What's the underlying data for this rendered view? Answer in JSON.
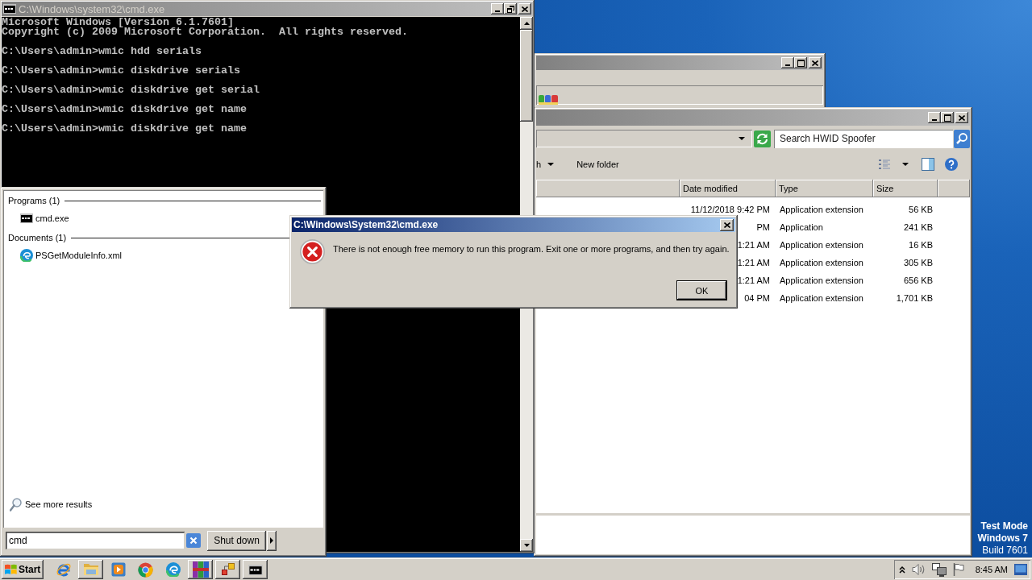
{
  "cmd_window": {
    "title": "C:\\Windows\\system32\\cmd.exe",
    "banner_lines": [
      "Microsoft Windows [Version 6.1.7601]",
      "Copyright (c) 2009 Microsoft Corporation.  All rights reserved."
    ],
    "command_lines": [
      "C:\\Users\\admin>wmic hdd serials",
      "C:\\Users\\admin>wmic diskdrive serials",
      "C:\\Users\\admin>wmic diskdrive get serial",
      "C:\\Users\\admin>wmic diskdrive get name",
      "C:\\Users\\admin>wmic diskdrive get name"
    ]
  },
  "explorer_window": {
    "search": {
      "placeholder": "Search HWID Spoofer"
    },
    "toolbar": [
      {
        "label": "h",
        "kind": "menu"
      },
      {
        "label": "New folder",
        "kind": "button"
      }
    ],
    "columns": [
      "Date modified",
      "Type",
      "Size"
    ],
    "rows": [
      {
        "date_modified": "11/12/2018 9:42 PM",
        "type": "Application extension",
        "size": "56 KB"
      },
      {
        "date_modified": "PM",
        "type": "Application",
        "size": "241 KB"
      },
      {
        "date_modified": "1:21 AM",
        "type": "Application extension",
        "size": "16 KB"
      },
      {
        "date_modified": "1:21 AM",
        "type": "Application extension",
        "size": "305 KB"
      },
      {
        "date_modified": "1:21 AM",
        "type": "Application extension",
        "size": "656 KB"
      },
      {
        "date_modified": "04 PM",
        "type": "Application extension",
        "size": "1,701 KB"
      }
    ]
  },
  "start_menu": {
    "groups": [
      {
        "heading": "Programs (1)",
        "items": [
          {
            "label": "cmd.exe",
            "kind": "program"
          }
        ]
      },
      {
        "heading": "Documents (1)",
        "items": [
          {
            "label": "PSGetModuleInfo.xml",
            "kind": "document"
          }
        ]
      }
    ],
    "see_more": "See more results",
    "search": {
      "value": "cmd"
    },
    "shutdown_button": "Shut down"
  },
  "error_dialog": {
    "title": "C:\\Windows\\System32\\cmd.exe",
    "message": "There is not enough free memory to run this program. Exit one or more programs, and then try again.",
    "button": "OK"
  },
  "desktop": {
    "notice_lines": [
      "Test Mode",
      "Windows 7",
      "Build 7601"
    ]
  },
  "taskbar": {
    "start_button": "Start",
    "items": [
      {
        "kind": "ie",
        "running": false
      },
      {
        "kind": "folder",
        "running": true
      },
      {
        "kind": "media",
        "running": false
      },
      {
        "kind": "chrome",
        "running": false
      },
      {
        "kind": "edge",
        "running": false
      },
      {
        "kind": "archive",
        "running": true
      },
      {
        "kind": "app",
        "running": true
      },
      {
        "kind": "console",
        "running": true
      }
    ],
    "clock": "8:45 AM"
  }
}
